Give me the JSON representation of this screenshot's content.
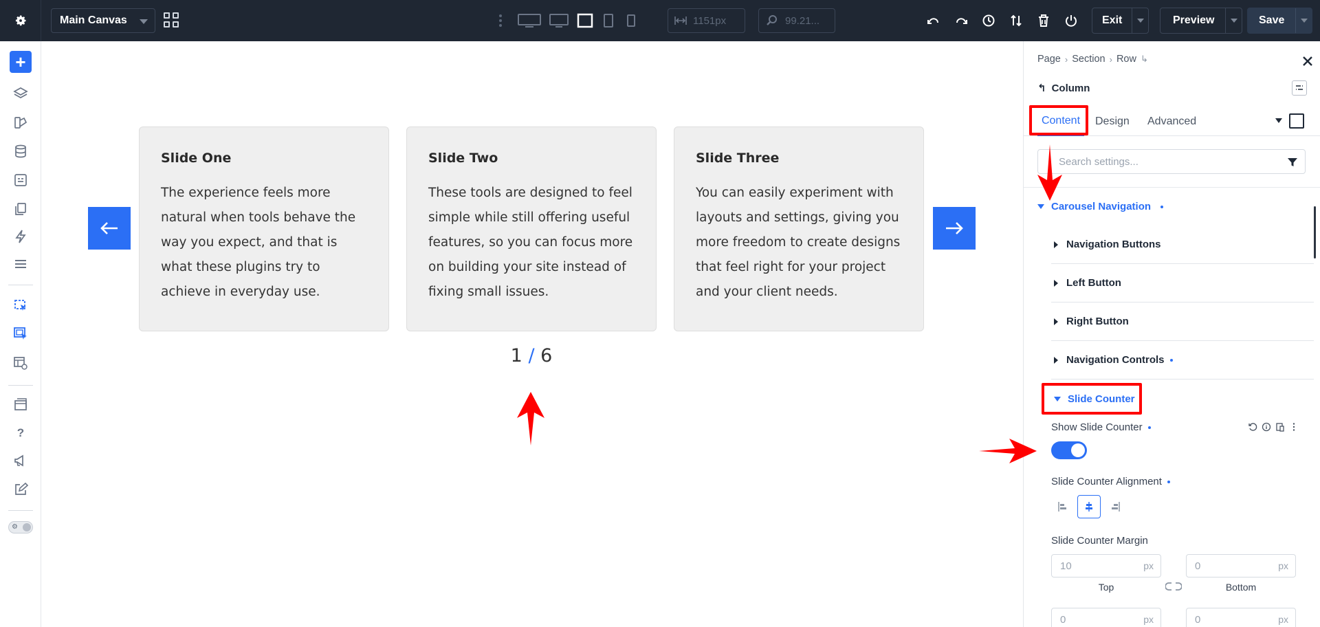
{
  "topbar": {
    "canvas_name": "Main Canvas",
    "width_value": "1151px",
    "zoom_value": "99.21...",
    "exit_label": "Exit",
    "preview_label": "Preview",
    "save_label": "Save"
  },
  "canvas": {
    "slides": [
      {
        "title": "Slide One",
        "text": "The experience feels more natural when tools behave the way you expect, and that is what these plugins try to achieve in everyday use."
      },
      {
        "title": "Slide Two",
        "text": "These tools are designed to feel simple while still offering useful features, so you can focus more on building your site instead of fixing small issues."
      },
      {
        "title": "Slide Three",
        "text": "You can easily experiment with layouts and settings, giving you more freedom to create designs that feel right for your project and your client needs."
      }
    ],
    "counter": {
      "current": "1",
      "separator": "/",
      "total": "6"
    }
  },
  "panel": {
    "breadcrumb": [
      "Page",
      "Section",
      "Row"
    ],
    "module_name": "Column",
    "tabs": [
      "Content",
      "Design",
      "Advanced"
    ],
    "active_tab": "Content",
    "search_placeholder": "Search settings...",
    "group_open": "Carousel Navigation",
    "subgroups": [
      "Navigation Buttons",
      "Left Button",
      "Right Button",
      "Navigation Controls"
    ],
    "section_open": "Slide Counter",
    "show_counter_label": "Show Slide Counter",
    "show_counter_on": true,
    "alignment_label": "Slide Counter Alignment",
    "alignment_selected": "center",
    "margin_label": "Slide Counter Margin",
    "margin": {
      "top": {
        "value": "10",
        "unit": "px",
        "caption": "Top"
      },
      "bottom": {
        "value": "0",
        "unit": "px",
        "caption": "Bottom"
      },
      "left": {
        "value": "0",
        "unit": "px"
      },
      "right": {
        "value": "0",
        "unit": "px"
      }
    }
  },
  "colors": {
    "accent": "#2b6ff5",
    "topbar_bg": "#1f2733",
    "annotation_red": "#ff0000"
  }
}
